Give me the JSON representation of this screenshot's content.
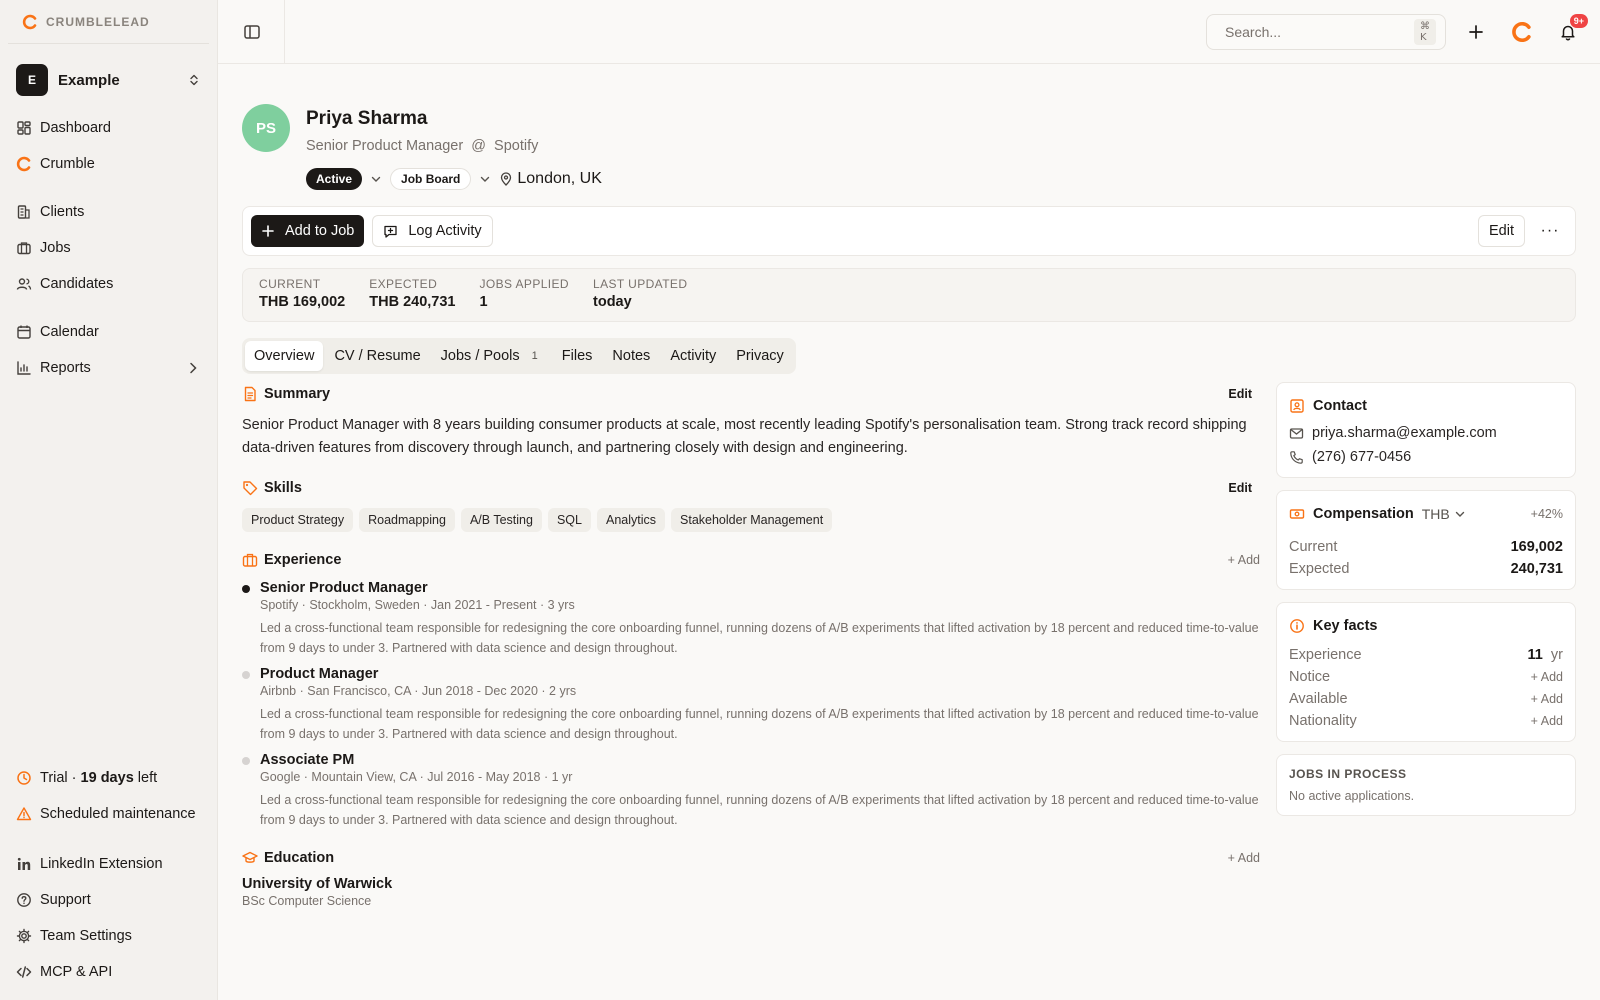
{
  "brand": {
    "name": "CRUMBLELEAD",
    "accent": "#f97316"
  },
  "workspace": {
    "initial": "E",
    "name": "Example"
  },
  "nav": {
    "main": [
      {
        "label": "Dashboard",
        "icon": "dashboard-icon"
      },
      {
        "label": "Crumble",
        "icon": "crumble-icon"
      }
    ],
    "records": [
      {
        "label": "Clients",
        "icon": "building-icon"
      },
      {
        "label": "Jobs",
        "icon": "briefcase-icon"
      },
      {
        "label": "Candidates",
        "icon": "users-icon"
      }
    ],
    "tools": [
      {
        "label": "Calendar",
        "icon": "calendar-icon"
      },
      {
        "label": "Reports",
        "icon": "chart-icon"
      }
    ],
    "bottom": {
      "trial_prefix": "Trial · ",
      "trial_days": "19 days",
      "trial_suffix": " left",
      "maintenance": "Scheduled maintenance",
      "linkedin": "LinkedIn Extension",
      "support": "Support",
      "team_settings": "Team Settings",
      "mcp": "MCP & API"
    }
  },
  "topbar": {
    "search_placeholder": "Search...",
    "search_shortcut": "⌘ K",
    "notifications_badge": "9+"
  },
  "candidate": {
    "initials": "PS",
    "first_name": "Priya",
    "last_name": "Sharma",
    "title": "Senior Product Manager",
    "at": "@",
    "company": "Spotify",
    "status": "Active",
    "source": "Job Board",
    "location": "London, UK"
  },
  "actions": {
    "add_to_job": "Add to Job",
    "log_activity": "Log Activity",
    "edit": "Edit",
    "more": "···"
  },
  "stats": [
    {
      "label": "CURRENT",
      "value": "THB 169,002"
    },
    {
      "label": "EXPECTED",
      "value": "THB 240,731"
    },
    {
      "label": "JOBS APPLIED",
      "value": "1"
    },
    {
      "label": "LAST UPDATED",
      "value": "today"
    }
  ],
  "tabs": {
    "overview": "Overview",
    "cv": "CV / Resume",
    "jobs": "Jobs / Pools",
    "jobs_count": "1",
    "files": "Files",
    "notes": "Notes",
    "activity": "Activity",
    "privacy": "Privacy"
  },
  "summary": {
    "title": "Summary",
    "edit": "Edit",
    "text": "Senior Product Manager with 8 years building consumer products at scale, most recently leading Spotify's personalisation team. Strong track record shipping data-driven features from discovery through launch, and partnering closely with design and engineering."
  },
  "skills": {
    "title": "Skills",
    "edit": "Edit",
    "items": [
      "Product Strategy",
      "Roadmapping",
      "A/B Testing",
      "SQL",
      "Analytics",
      "Stakeholder Management"
    ]
  },
  "experience": {
    "title": "Experience",
    "add": "+ Add",
    "items": [
      {
        "title": "Senior Product Manager",
        "meta": "Spotify · Stockholm, Sweden · Jan 2021 - Present · 3 yrs",
        "desc": "Led a cross-functional team responsible for redesigning the core onboarding funnel, running dozens of A/B experiments that lifted activation by 18 percent and reduced time-to-value from 9 days to under 3. Partnered with data science and design throughout."
      },
      {
        "title": "Product Manager",
        "meta": "Airbnb · San Francisco, CA · Jun 2018 - Dec 2020 · 2 yrs",
        "desc": "Led a cross-functional team responsible for redesigning the core onboarding funnel, running dozens of A/B experiments that lifted activation by 18 percent and reduced time-to-value from 9 days to under 3. Partnered with data science and design throughout."
      },
      {
        "title": "Associate PM",
        "meta": "Google · Mountain View, CA · Jul 2016 - May 2018 · 1 yr",
        "desc": "Led a cross-functional team responsible for redesigning the core onboarding funnel, running dozens of A/B experiments that lifted activation by 18 percent and reduced time-to-value from 9 days to under 3. Partnered with data science and design throughout."
      }
    ]
  },
  "education": {
    "title": "Education",
    "add": "+ Add",
    "school": "University of Warwick",
    "degree": "BSc Computer Science"
  },
  "contact": {
    "title": "Contact",
    "email": "priya.sharma@example.com",
    "phone": "(276) 677-0456"
  },
  "compensation": {
    "title": "Compensation",
    "currency": "THB",
    "change": "+42%",
    "current_label": "Current",
    "current_value": "169,002",
    "expected_label": "Expected",
    "expected_value": "240,731"
  },
  "key_facts": {
    "title": "Key facts",
    "experience_label": "Experience",
    "experience_value": "11",
    "experience_unit": "yr",
    "notice_label": "Notice",
    "available_label": "Available",
    "nationality_label": "Nationality",
    "add": "+ Add"
  },
  "jobs_in_process": {
    "title": "JOBS IN PROCESS",
    "empty": "No active applications."
  }
}
